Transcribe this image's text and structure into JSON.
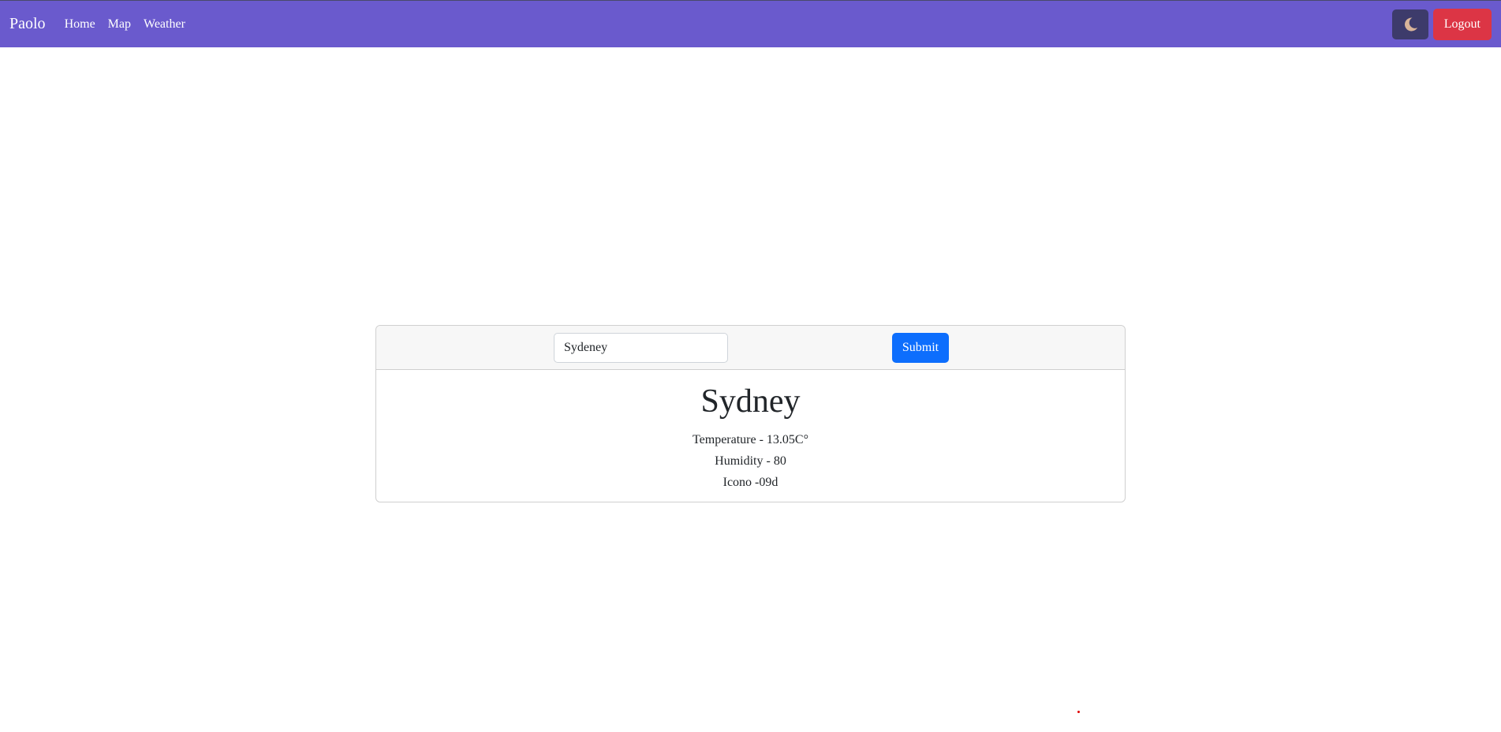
{
  "navbar": {
    "brand": "Paolo",
    "links": [
      "Home",
      "Map",
      "Weather"
    ],
    "theme_icon": "moon-icon",
    "logout_label": "Logout"
  },
  "search": {
    "value": "Sydeney",
    "submit_label": "Submit"
  },
  "weather": {
    "city": "Sydney",
    "temperature": "Temperature - 13.05C°",
    "humidity": "Humidity - 80",
    "icon": "Icono -09d"
  },
  "colors": {
    "navbar": "#6a5acd",
    "theme_button": "#3d3b6b",
    "logout_button": "#dc3545",
    "submit_button": "#0d6efd",
    "moon": "#d9b59a"
  }
}
